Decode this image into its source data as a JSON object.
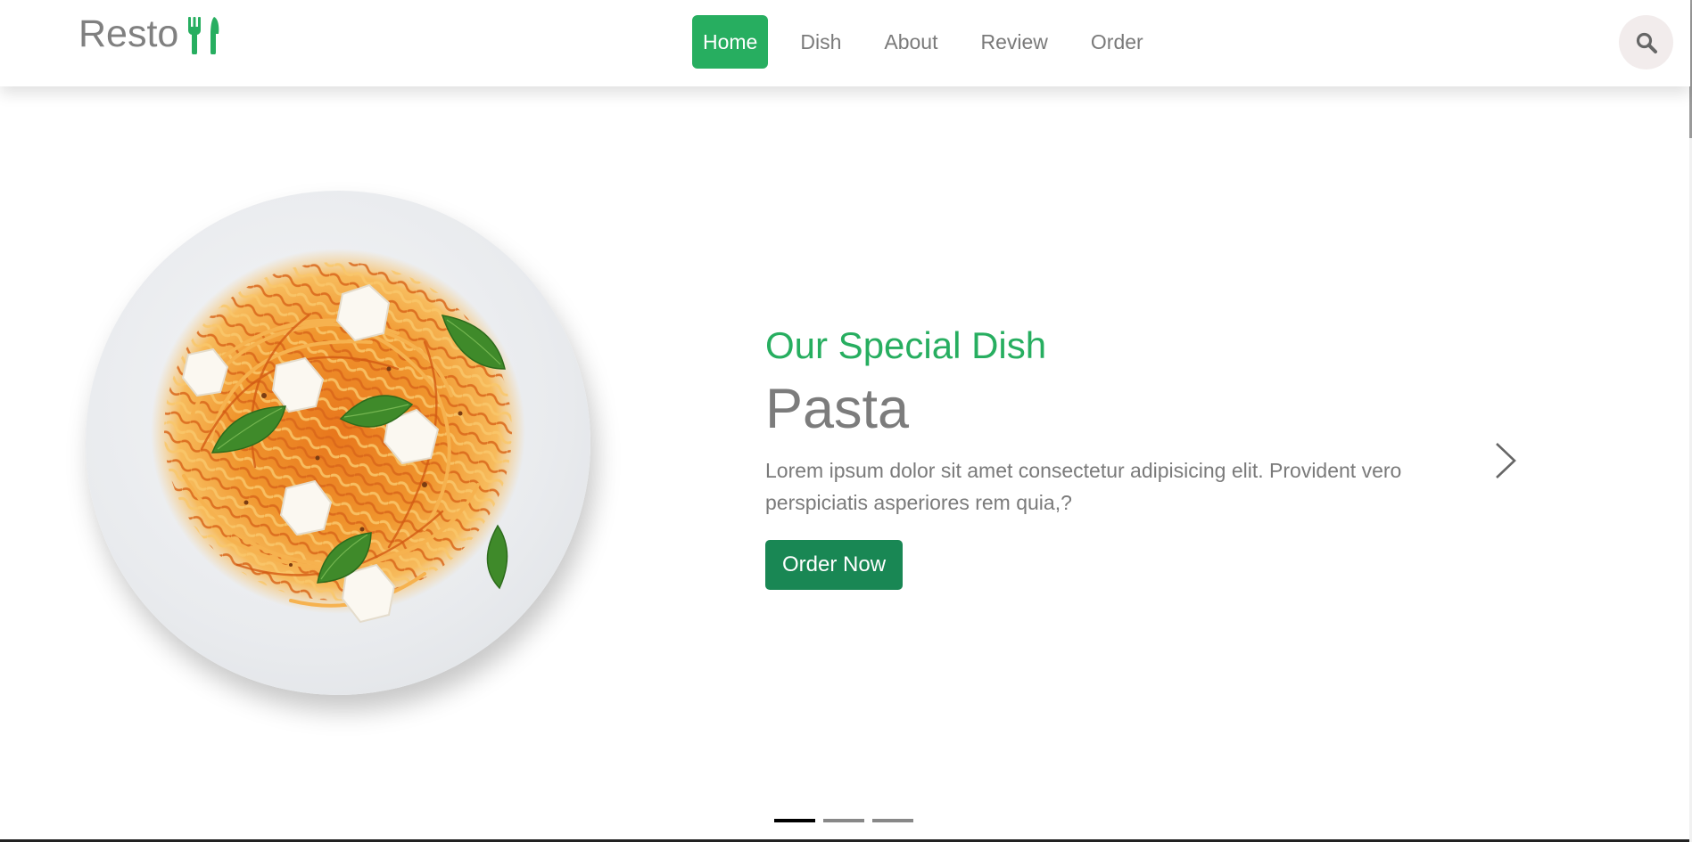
{
  "header": {
    "logo_text": "Resto",
    "logo_icon": "utensils-icon",
    "nav": [
      {
        "label": "Home",
        "active": true
      },
      {
        "label": "Dish",
        "active": false
      },
      {
        "label": "About",
        "active": false
      },
      {
        "label": "Review",
        "active": false
      },
      {
        "label": "Order",
        "active": false
      }
    ],
    "search_icon": "search-icon"
  },
  "hero": {
    "image": "pasta-plate",
    "subtitle": "Our Special Dish",
    "title": "Pasta",
    "description": "Lorem ipsum dolor sit amet consectetur adipisicing elit. Provident vero perspiciatis asperiores rem quia,?",
    "cta_label": "Order Now",
    "next_icon": "chevron-right-icon",
    "slides": 3,
    "active_slide": 1
  },
  "colors": {
    "accent": "#27ae60",
    "button": "#198754",
    "text": "#7a7a7a",
    "search_bg": "#f2ecec"
  }
}
